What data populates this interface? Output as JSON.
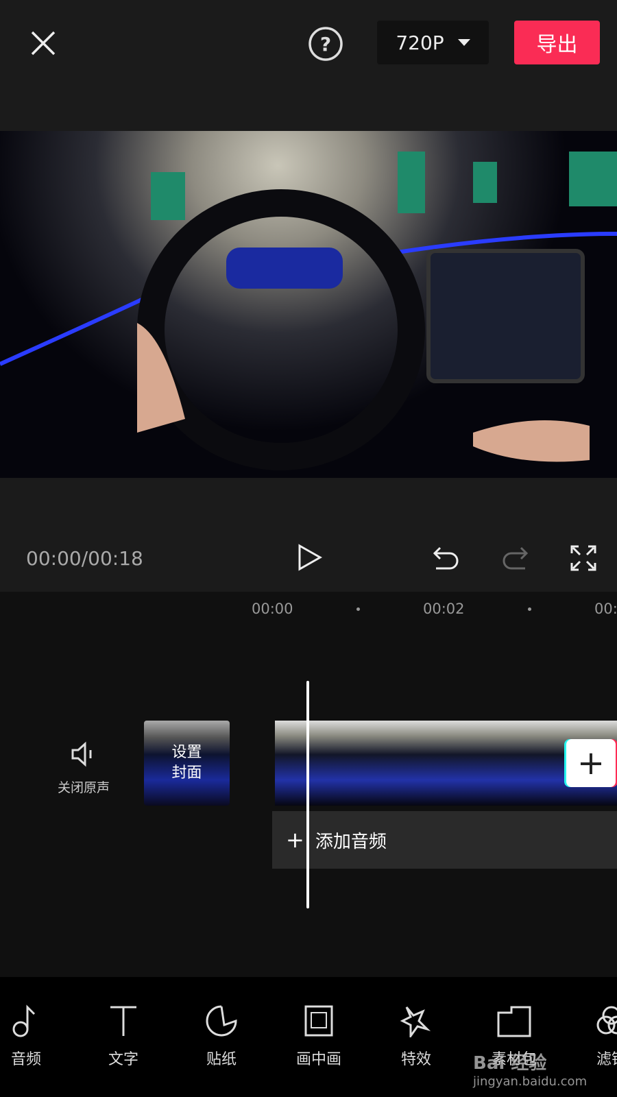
{
  "header": {
    "close_icon": "close-icon",
    "help_icon": "question-circle-icon",
    "resolution": "720P",
    "export_label": "导出",
    "export_color": "#fa2c55"
  },
  "player": {
    "time": "00:00/00:18"
  },
  "ruler": [
    "00:00",
    "00:02",
    "00:"
  ],
  "timeline": {
    "mute_label": "关闭原声",
    "cover_label_1": "设置",
    "cover_label_2": "封面",
    "add_audio_label": "添加音频"
  },
  "toolbar": [
    {
      "label": "音频",
      "icon": "music-note-icon"
    },
    {
      "label": "文字",
      "icon": "text-icon"
    },
    {
      "label": "贴纸",
      "icon": "sticker-icon"
    },
    {
      "label": "画中画",
      "icon": "picture-in-picture-icon"
    },
    {
      "label": "特效",
      "icon": "effects-star-icon"
    },
    {
      "label": "素材包",
      "icon": "material-pack-icon"
    },
    {
      "label": "滤镜",
      "icon": "filter-icon"
    }
  ],
  "watermark": {
    "text": "Bai 经验",
    "url": "jingyan.baidu.com"
  }
}
